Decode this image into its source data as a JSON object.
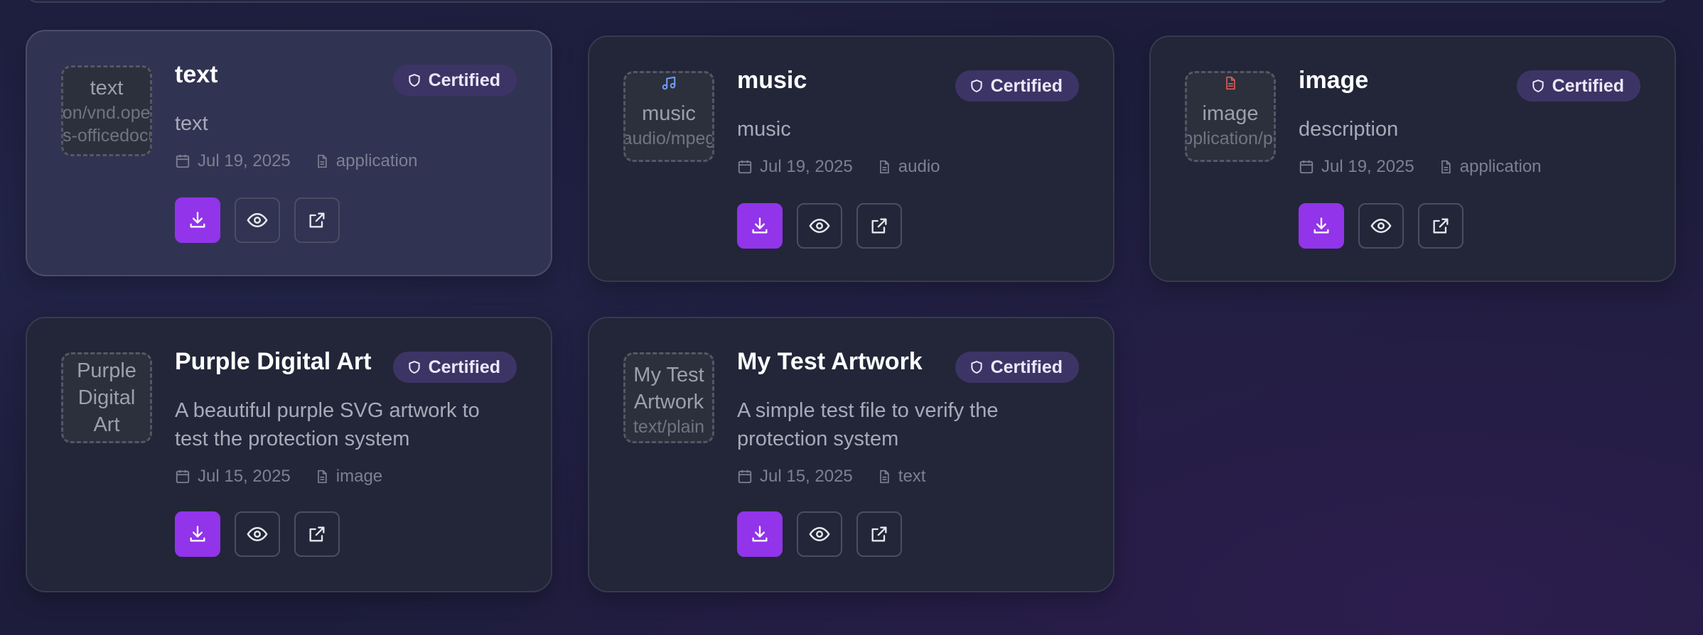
{
  "cards": [
    {
      "title": "text",
      "description": "text",
      "thumb_name": "text",
      "thumb_mime": "application/vnd.openxmlformats-officedocument.wordprocessingml",
      "thumb_icon": "",
      "badge": "Certified",
      "date": "Jul 19, 2025",
      "type": "application"
    },
    {
      "title": "music",
      "description": "music",
      "thumb_name": "music",
      "thumb_mime": "audio/mpeg",
      "thumb_icon": "music-note-icon",
      "badge": "Certified",
      "date": "Jul 19, 2025",
      "type": "audio"
    },
    {
      "title": "image",
      "description": "description",
      "thumb_name": "image",
      "thumb_mime": "application/pdf",
      "thumb_icon": "document-icon",
      "badge": "Certified",
      "date": "Jul 19, 2025",
      "type": "application"
    },
    {
      "title": "Purple Digital Art",
      "description": "A beautiful purple SVG artwork to test the protection system",
      "thumb_name": "Purple Digital Art",
      "thumb_mime": "",
      "thumb_icon": "",
      "badge": "Certified",
      "date": "Jul 15, 2025",
      "type": "image"
    },
    {
      "title": "My Test Artwork",
      "description": "A simple test file to verify the protection system",
      "thumb_name": "My Test Artwork",
      "thumb_mime": "text/plain",
      "thumb_icon": "",
      "badge": "Certified",
      "date": "Jul 15, 2025",
      "type": "text"
    }
  ],
  "actions": [
    "download-icon",
    "eye-icon",
    "external-link-icon"
  ],
  "colors": {
    "background": "#1d1d3b",
    "card": "#222638",
    "card_highlight": "#313352",
    "primary_button": "#9234ea",
    "badge_bg": "#3d3466",
    "music_icon": "#6f9ef5",
    "document_icon": "#e05a5a"
  }
}
